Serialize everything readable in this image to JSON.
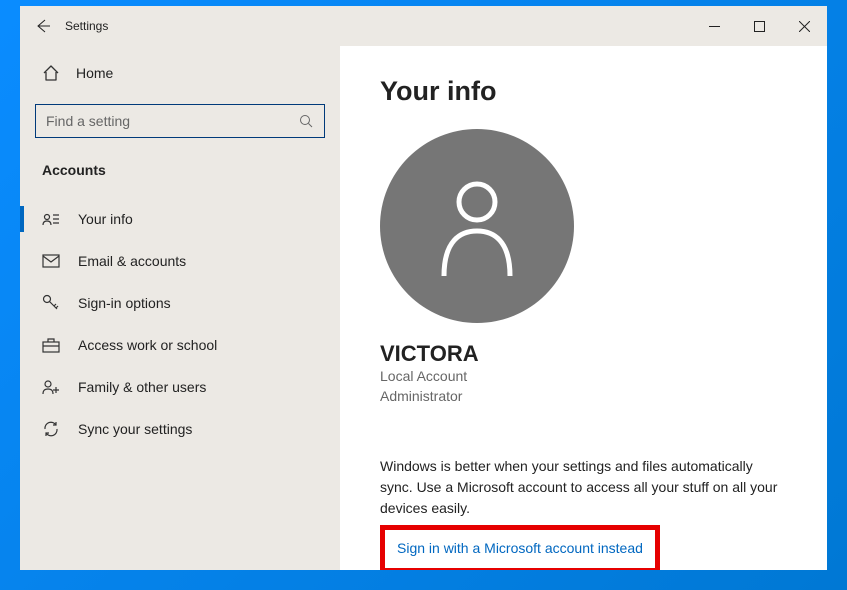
{
  "window": {
    "title": "Settings"
  },
  "sidebar": {
    "home_label": "Home",
    "search_placeholder": "Find a setting",
    "category": "Accounts",
    "items": [
      {
        "label": "Your info"
      },
      {
        "label": "Email & accounts"
      },
      {
        "label": "Sign-in options"
      },
      {
        "label": "Access work or school"
      },
      {
        "label": "Family & other users"
      },
      {
        "label": "Sync your settings"
      }
    ]
  },
  "main": {
    "page_title": "Your info",
    "username": "VICTORA",
    "account_type": "Local Account",
    "role": "Administrator",
    "description": "Windows is better when your settings and files automatically sync. Use a Microsoft account to access all your stuff on all your devices easily.",
    "signin_link": "Sign in with a Microsoft account instead"
  }
}
